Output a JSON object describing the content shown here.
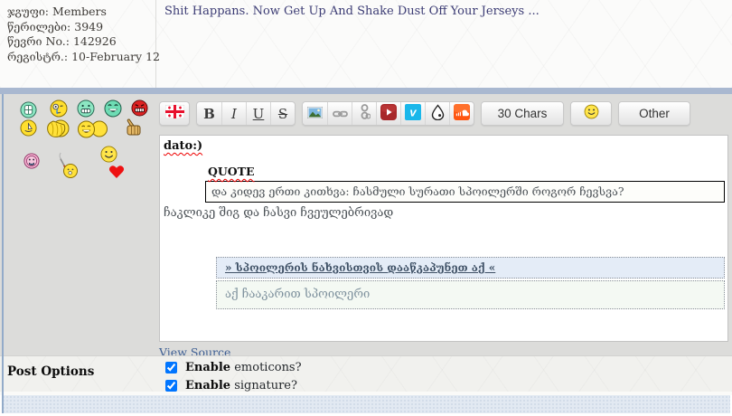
{
  "user_info": {
    "rows": [
      {
        "label": "ჯგუფი:",
        "value": "Members"
      },
      {
        "label": "წერილები:",
        "value": "3949"
      },
      {
        "label": "წევრი No.:",
        "value": "142926"
      },
      {
        "label": "რეგისტრ.:",
        "value": "10-February 12"
      }
    ]
  },
  "thread_title": "Shit Happans. Now Get Up And Shake Dust Off Your Jerseys ...",
  "emoticons": [
    "teeth-smiley",
    "wink-cry-smiley",
    "grin-smiley",
    "laugh-smiley",
    "angry-smiley",
    "sail-smiley",
    "facepalm-smiley",
    "rofl-pair-smiley",
    "thumbs-up",
    "pink-smiley",
    "smoking-smiley",
    "classic-smiley",
    "heart"
  ],
  "toolbar": {
    "bold_label": "B",
    "italic_label": "I",
    "underline_label": "U",
    "strike_label": "S",
    "chars_button_label": "30 Chars",
    "other_tab_label": "Other",
    "icons": [
      "georgian-flag-icon",
      "image-icon",
      "link-icon",
      "unlink-icon",
      "youtube-icon",
      "vimeo-icon",
      "drop-icon",
      "soundcloud-icon",
      "smiley-icon"
    ]
  },
  "editor": {
    "line1": "dato:)",
    "quote_label": "QUOTE",
    "quote_text": "და კიდევ ერთი კითხვა: ჩასმული სურათი სპოილერში როგორ ჩევსვა?",
    "reply_text": "ჩაკლიკე შიგ და ჩასვი ჩვეულებრივად",
    "spoiler_header": "» სპოილერის ნახვისთვის დააწკაპუნეთ აქ «",
    "spoiler_content": "აქ ჩააკარით სპოილერი",
    "view_source_label": "View Source"
  },
  "post_options": {
    "title": "Post Options",
    "options": [
      {
        "bold": "Enable",
        "rest": " emoticons?",
        "checked": true
      },
      {
        "bold": "Enable",
        "rest": " signature?",
        "checked": true
      }
    ]
  },
  "colors": {
    "accent_band": "#a9b8d0",
    "section_bg": "#dcdcda",
    "footer_bg": "#e2e9f2",
    "title": "#3c3c74",
    "link": "#3d5e93",
    "youtube": "#a8282a",
    "vimeo": "#1ab7ea",
    "soundcloud": "#ff5510"
  }
}
